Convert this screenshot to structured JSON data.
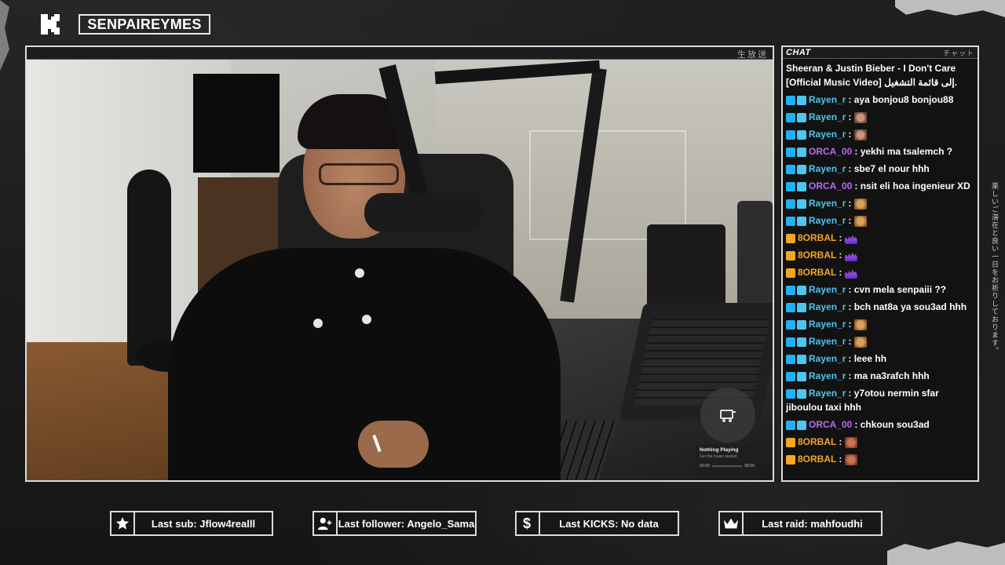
{
  "channel": {
    "name": "SENPAIREYMES",
    "logo_icon": "kick-logo-icon"
  },
  "video": {
    "jp_label": "生放送",
    "now_playing": {
      "title": "Nothing Playing",
      "subtitle": "Get the music started",
      "time_start": "00:00",
      "time_end": "00:00"
    }
  },
  "chat": {
    "header": "CHAT",
    "header_jp": "チャット",
    "messages": [
      {
        "user": "",
        "color": "#ffffff",
        "badges": [],
        "text": "Sheeran & Justin Bieber - I Don't Care [Official Music Video] إلى قائمة التشغيل.",
        "emotes": []
      },
      {
        "user": "Rayen_r",
        "color": "#4ec6f0",
        "badges": [
          "kick",
          "mod"
        ],
        "text": "aya bonjou8 bonjou88",
        "emotes": []
      },
      {
        "user": "Rayen_r",
        "color": "#4ec6f0",
        "badges": [
          "kick",
          "mod"
        ],
        "text": "",
        "emotes": [
          "face"
        ]
      },
      {
        "user": "Rayen_r",
        "color": "#4ec6f0",
        "badges": [
          "kick",
          "mod"
        ],
        "text": "",
        "emotes": [
          "face"
        ]
      },
      {
        "user": "ORCA_00",
        "color": "#b86cf0",
        "badges": [
          "kick",
          "mod"
        ],
        "text": "yekhi ma tsalemch ?",
        "emotes": []
      },
      {
        "user": "Rayen_r",
        "color": "#4ec6f0",
        "badges": [
          "kick",
          "mod"
        ],
        "text": "sbe7 el nour hhh",
        "emotes": []
      },
      {
        "user": "ORCA_00",
        "color": "#b86cf0",
        "badges": [
          "kick",
          "mod"
        ],
        "text": "nsit eli hoa ingenieur XD",
        "emotes": []
      },
      {
        "user": "Rayen_r",
        "color": "#4ec6f0",
        "badges": [
          "kick",
          "mod"
        ],
        "text": "",
        "emotes": [
          "face2"
        ]
      },
      {
        "user": "Rayen_r",
        "color": "#4ec6f0",
        "badges": [
          "kick",
          "mod"
        ],
        "text": "",
        "emotes": [
          "face2"
        ]
      },
      {
        "user": "8ORBAL",
        "color": "#f5a623",
        "badges": [
          "sub"
        ],
        "text": "",
        "emotes": [
          "wave"
        ]
      },
      {
        "user": "8ORBAL",
        "color": "#f5a623",
        "badges": [
          "sub"
        ],
        "text": "",
        "emotes": [
          "wave"
        ]
      },
      {
        "user": "8ORBAL",
        "color": "#f5a623",
        "badges": [
          "sub"
        ],
        "text": "",
        "emotes": [
          "wave"
        ]
      },
      {
        "user": "Rayen_r",
        "color": "#4ec6f0",
        "badges": [
          "kick",
          "mod"
        ],
        "text": "cvn mela senpaiii ??",
        "emotes": []
      },
      {
        "user": "Rayen_r",
        "color": "#4ec6f0",
        "badges": [
          "kick",
          "mod"
        ],
        "text": "bch nat8a ya sou3ad hhh",
        "emotes": []
      },
      {
        "user": "Rayen_r",
        "color": "#4ec6f0",
        "badges": [
          "kick",
          "mod"
        ],
        "text": "",
        "emotes": [
          "face2"
        ]
      },
      {
        "user": "Rayen_r",
        "color": "#4ec6f0",
        "badges": [
          "kick",
          "mod"
        ],
        "text": "",
        "emotes": [
          "face2"
        ]
      },
      {
        "user": "Rayen_r",
        "color": "#4ec6f0",
        "badges": [
          "kick",
          "mod"
        ],
        "text": "leee hh",
        "emotes": []
      },
      {
        "user": "Rayen_r",
        "color": "#4ec6f0",
        "badges": [
          "kick",
          "mod"
        ],
        "text": "ma na3rafch hhh",
        "emotes": []
      },
      {
        "user": "Rayen_r",
        "color": "#4ec6f0",
        "badges": [
          "kick",
          "mod"
        ],
        "text": "y7otou nermin sfar jiboulou taxi hhh",
        "emotes": []
      },
      {
        "user": "ORCA_00",
        "color": "#b86cf0",
        "badges": [
          "kick",
          "mod"
        ],
        "text": "chkoun sou3ad",
        "emotes": []
      },
      {
        "user": "8ORBAL",
        "color": "#f5a623",
        "badges": [
          "sub"
        ],
        "text": "",
        "emotes": [
          "face3"
        ]
      },
      {
        "user": "8ORBAL",
        "color": "#f5a623",
        "badges": [
          "sub"
        ],
        "text": "",
        "emotes": [
          "face3"
        ]
      }
    ]
  },
  "side_jp_text": "楽しいご滞在と良い一日をお祈りしております。",
  "stats": {
    "last_sub": "Last sub: Jflow4realll",
    "last_follower": "Last follower: Angelo_Sama",
    "last_kicks": "Last KICKS: No data",
    "last_raid": "Last raid: mahfoudhi"
  },
  "colors": {
    "frame": "#dcdcdc",
    "kick_green": "#53fc18",
    "rayen": "#4ec6f0",
    "orca": "#b86cf0",
    "orbal": "#f5a623"
  }
}
